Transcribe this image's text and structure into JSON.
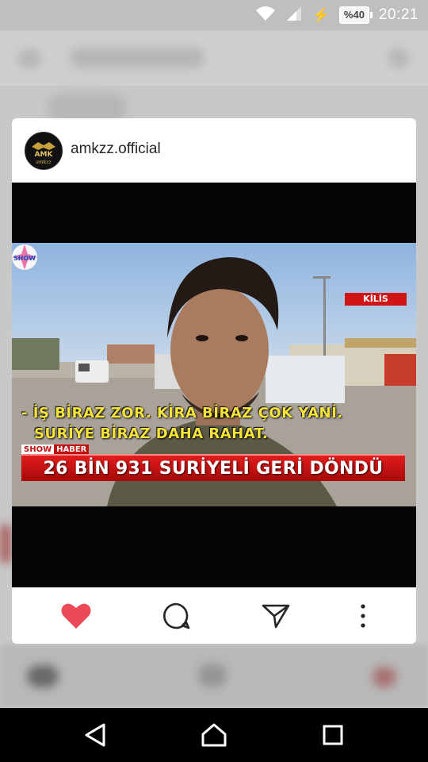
{
  "status_bar": {
    "time": "20:21",
    "battery": "%40",
    "icons": [
      "wifi-icon",
      "signal-icon",
      "charging-icon",
      "battery-icon"
    ]
  },
  "post": {
    "username": "amkzz.official",
    "avatar_text": "AMK",
    "avatar_subtext": "amkzz",
    "media": {
      "channel_logo": "SHOW",
      "location": "KİLİS",
      "subtitle_line1": "- İŞ BİRAZ ZOR. KİRA BİRAZ ÇOK YANİ.",
      "subtitle_line2": "SURİYE BİRAZ DAHA RAHAT.",
      "tag_part1": "SHOW",
      "tag_part2": "HABER",
      "headline": "26 BİN 931 SURİYELİ GERİ DÖNDÜ"
    },
    "actions": [
      "heart-icon",
      "comment-icon",
      "share-icon",
      "more-icon"
    ],
    "colors": {
      "like": "#ed4956",
      "subtitle": "#f6e43a",
      "banner": "#d81616"
    }
  },
  "nav": [
    "back-icon",
    "home-icon",
    "recents-icon"
  ]
}
